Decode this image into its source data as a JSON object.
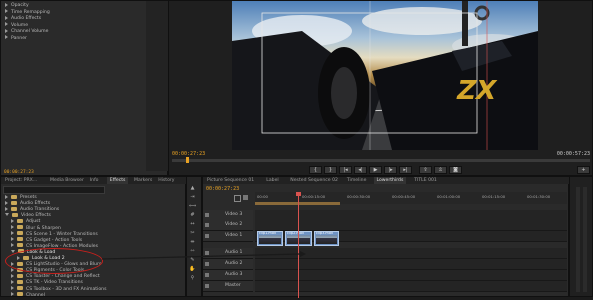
{
  "effect_controls": {
    "items": [
      {
        "label": "Opacity",
        "expanded": false
      },
      {
        "label": "Time Remapping",
        "expanded": false
      },
      {
        "label": "Audio Effects",
        "expanded": false,
        "header": true
      },
      {
        "label": "Volume",
        "expanded": false
      },
      {
        "label": "Channel Volume",
        "expanded": false
      },
      {
        "label": "Panner",
        "expanded": false
      }
    ],
    "timecode": "00:00:27:23"
  },
  "program_monitor": {
    "timecode_left": "00:00:27:23",
    "timecode_right": "00:00:57:23",
    "overlay_text": "ZX"
  },
  "project_panel": {
    "tabs": [
      "Project: PRX...",
      "Media Browser",
      "Info",
      "Effects",
      "Markers",
      "History"
    ],
    "active_tab": "Effects",
    "items": [
      {
        "label": "Presets",
        "level": 0,
        "expanded": false
      },
      {
        "label": "Audio Effects",
        "level": 0,
        "expanded": false
      },
      {
        "label": "Audio Transitions",
        "level": 0,
        "expanded": false
      },
      {
        "label": "Video Effects",
        "level": 0,
        "expanded": true
      },
      {
        "label": "Adjust",
        "level": 1,
        "expanded": false
      },
      {
        "label": "Blur & Sharpen",
        "level": 1,
        "expanded": false
      },
      {
        "label": "CS Scene 1 - Winter Transitions",
        "level": 1,
        "expanded": false
      },
      {
        "label": "CS Gadget - Action Tools",
        "level": 1,
        "expanded": false
      },
      {
        "label": "CS ImageFlow - Action Modules",
        "level": 1,
        "expanded": false
      },
      {
        "label": "Look & Load",
        "level": 1,
        "expanded": true,
        "highlight": true
      },
      {
        "label": "Look & Load 2",
        "level": 2,
        "expanded": false,
        "highlight": true
      },
      {
        "label": "CS LightStudio - Glows and Blurs",
        "level": 1,
        "expanded": false
      },
      {
        "label": "CS Pigments - Color Tools",
        "level": 1,
        "expanded": false
      },
      {
        "label": "CS Toaster - Change and Reflect",
        "level": 1,
        "expanded": false
      },
      {
        "label": "CS TK - Video Transitions",
        "level": 1,
        "expanded": false
      },
      {
        "label": "CS Toolbox - 3D and FX Animations",
        "level": 1,
        "expanded": false
      },
      {
        "label": "Channel",
        "level": 1,
        "expanded": false
      }
    ],
    "timecode": "00:00:27:23"
  },
  "timeline": {
    "tabs": [
      "Picture Sequence 01",
      "Label",
      "Nested Sequence 02",
      "Timeline",
      "Lowerthirds",
      "TITLE 001"
    ],
    "active_tab": "Lowerthirds",
    "timecode": "00:00:27:23",
    "ruler_labels": [
      "00:00",
      "00:00:15:00",
      "00:00:30:00",
      "00:00:45:00",
      "00:01:00:00",
      "00:01:15:00",
      "00:01:30:00",
      "00:01:45:00"
    ],
    "tracks": [
      {
        "label": "Video 3"
      },
      {
        "label": "Video 2"
      },
      {
        "label": "Video 1"
      },
      {
        "label": "Audio 1"
      },
      {
        "label": "Audio 2"
      },
      {
        "label": "Audio 3"
      },
      {
        "label": "Master"
      }
    ],
    "clips": [
      {
        "label": "clip1.mov"
      },
      {
        "label": "clip2.mov"
      },
      {
        "label": "clip3.mov"
      }
    ]
  },
  "colors": {
    "timecode": "#e8a224",
    "annotation_circle": "#c8201c",
    "playhead": "#d9534f",
    "clip": "#6f93c4"
  }
}
